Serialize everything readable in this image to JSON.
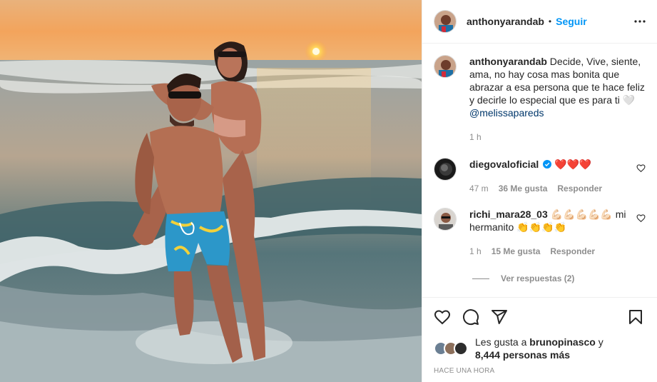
{
  "post": {
    "author": "anthonyarandab",
    "follow_label": "Seguir",
    "dot": "•",
    "caption_text": "Decide, Vive, siente, ama, no hay cosa mas bonita que abrazar a esa persona que te hace feliz y decirle lo especial que es para ti 🤍",
    "caption_mention": "@melissapareds",
    "caption_time": "1 h"
  },
  "comments": [
    {
      "user": "diegovaloficial",
      "text": "❤️❤️❤️",
      "time": "47 m",
      "likes": "36 Me gusta",
      "reply": "Responder",
      "verified": true
    },
    {
      "user": "richi_mara28_03",
      "text": "💪🏻💪🏻💪🏻💪🏻💪🏻 mi hermanito 👏👏👏👏",
      "time": "1 h",
      "likes": "15 Me gusta",
      "reply": "Responder"
    }
  ],
  "view_replies": "Ver respuestas (2)",
  "likes": {
    "prefix": "Les gusta a",
    "user": "brunopinasco",
    "joiner": "y",
    "others": "8,444 personas más"
  },
  "time_ago": "HACE UNA HORA",
  "colors": {
    "accent": "#0095f6",
    "mention": "#00376b",
    "heart": "#c8102e",
    "muted": "#8e8e8e"
  },
  "icons": [
    "more-icon",
    "heart-icon",
    "comment-icon",
    "share-icon",
    "save-icon",
    "verified-icon"
  ]
}
